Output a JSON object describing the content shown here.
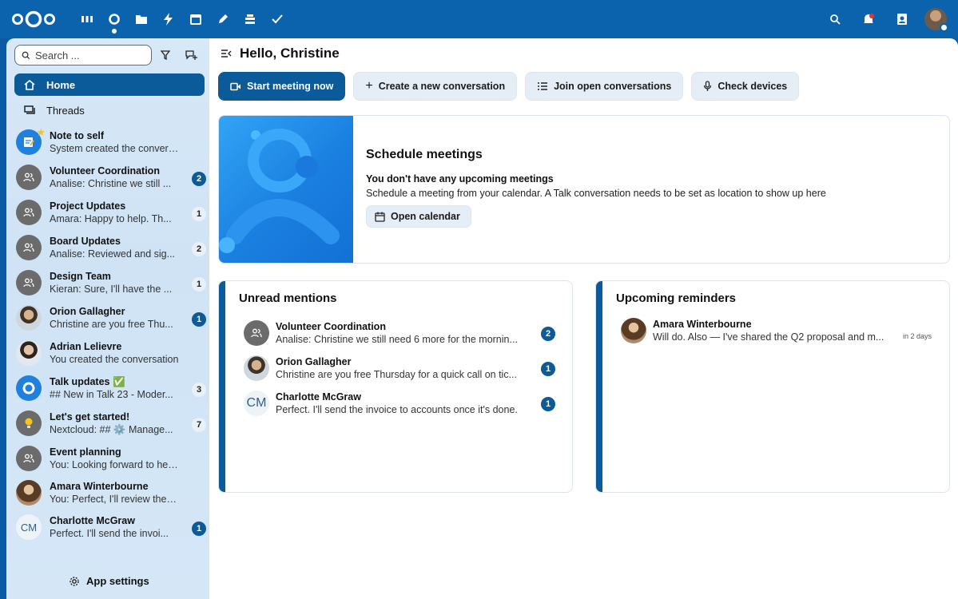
{
  "topbar": {
    "apps": [
      "dashboard-icon",
      "talk-icon",
      "files-icon",
      "activity-icon",
      "calendar-icon",
      "notes-icon",
      "deck-icon",
      "tasks-icon"
    ],
    "accent": "#0b63ad"
  },
  "sidebar": {
    "search": {
      "placeholder": "Search ...",
      "value": ""
    },
    "home_label": "Home",
    "threads_label": "Threads",
    "conversations": [
      {
        "name": "Note to self",
        "message": "System created the conversati...",
        "badge": "",
        "avatar": "note"
      },
      {
        "name": "Volunteer Coordination",
        "message": "Analise: Christine we still ...",
        "badge": "2",
        "avatar": "group"
      },
      {
        "name": "Project Updates",
        "message": "Amara: Happy to help. Th...",
        "badge": "1",
        "avatar": "group"
      },
      {
        "name": "Board Updates",
        "message": "Analise: Reviewed and sig...",
        "badge": "2",
        "avatar": "group"
      },
      {
        "name": "Design Team",
        "message": "Kieran: Sure, I'll have the ...",
        "badge": "1",
        "avatar": "group"
      },
      {
        "name": "Orion Gallagher",
        "message": "Christine are you free Thu...",
        "badge": "1",
        "avatar": "photo"
      },
      {
        "name": "Adrian Lelievre",
        "message": "You created the conversation",
        "badge": "",
        "avatar": "photo"
      },
      {
        "name": "Talk updates ✅",
        "message": "## New in Talk 23 - Moder...",
        "badge": "3",
        "avatar": "talk"
      },
      {
        "name": "Let's get started!",
        "message": "Nextcloud: ## ⚙️ Manage...",
        "badge": "7",
        "avatar": "bulb"
      },
      {
        "name": "Event planning",
        "message": "You: Looking forward to heari...",
        "badge": "",
        "avatar": "group"
      },
      {
        "name": "Amara Winterbourne",
        "message": "You: Perfect, I'll review them b...",
        "badge": "",
        "avatar": "photo"
      },
      {
        "name": "Charlotte McGraw",
        "message": "Perfect. I'll send the invoi...",
        "badge": "1",
        "avatar": "CM"
      }
    ],
    "app_settings_label": "App settings"
  },
  "main": {
    "greeting": "Hello, Christine",
    "actions": {
      "start_meeting": "Start meeting now",
      "create_conversation": "Create a new conversation",
      "join_open": "Join open conversations",
      "check_devices": "Check devices"
    },
    "schedule": {
      "title": "Schedule meetings",
      "subtitle": "You don't have any upcoming meetings",
      "description": "Schedule a meeting from your calendar. A Talk conversation needs to be set as location to show up here",
      "open_calendar": "Open calendar"
    },
    "unread_mentions": {
      "title": "Unread mentions",
      "items": [
        {
          "name": "Volunteer Coordination",
          "message": "Analise: Christine we still need 6 more for the mornin...",
          "badge": "2"
        },
        {
          "name": "Orion Gallagher",
          "message": "Christine are you free Thursday for a quick call on tic...",
          "badge": "1"
        },
        {
          "name": "Charlotte McGraw",
          "message": "Perfect. I'll send the invoice to accounts once it's done.",
          "badge": "1",
          "initials": "CM"
        }
      ]
    },
    "reminders": {
      "title": "Upcoming reminders",
      "items": [
        {
          "name": "Amara Winterbourne",
          "message": "Will do. Also — I've shared the Q2 proposal and m...",
          "when": "in 2 days"
        }
      ]
    }
  }
}
